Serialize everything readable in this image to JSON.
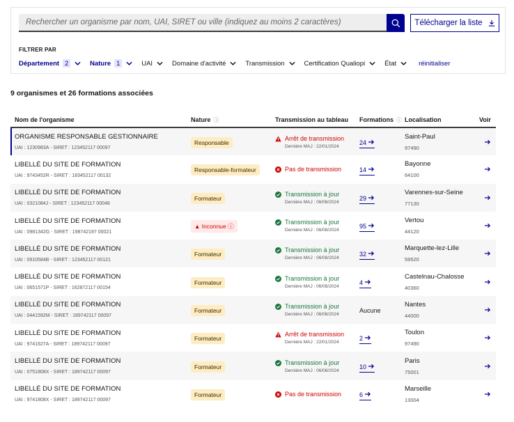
{
  "search": {
    "placeholder": "Rechercher un organisme par nom, UAI, SIRET ou ville (indiquez au moins 2 caractères)",
    "download_label": "Télécharger la liste"
  },
  "filters": {
    "title": "FILTRER PAR",
    "items": [
      {
        "label": "Département",
        "count": "2",
        "active": true
      },
      {
        "label": "Nature",
        "count": "1",
        "active": true
      },
      {
        "label": "UAI",
        "active": false
      },
      {
        "label": "Domaine d'activité",
        "active": false
      },
      {
        "label": "Transmission",
        "active": false
      },
      {
        "label": "Certification Qualiopi",
        "active": false
      },
      {
        "label": "État",
        "active": false
      }
    ],
    "reset_label": "réinitialiser"
  },
  "summary": "9 organismes et 26 formations associées",
  "table": {
    "headers": {
      "name": "Nom de l'organisme",
      "nature": "Nature",
      "transmission": "Transmission au tableau",
      "formations": "Formations",
      "location": "Localisation",
      "view": "Voir"
    },
    "rows": [
      {
        "name": "ORGANISME RESPONSABLE GESTIONNAIRE",
        "ids": "UAI : 1230983A - SIRET : 123452117 00097",
        "nature": "Responsable",
        "nature_style": "yellow",
        "tx_status": "ko-warn",
        "tx_label": "Arrêt de transmission",
        "tx_date": "Dernière MAJ : 22/01/2024",
        "formations": "24",
        "city": "Saint-Paul",
        "zip": "97490"
      },
      {
        "name": "LIBELLÉ DU SITE DE FORMATION",
        "ids": "UAI : 9743452R - SIRET : 183452117 00132",
        "nature": "Responsable-formateur",
        "nature_style": "yellow",
        "tx_status": "ko-none",
        "tx_label": "Pas de transmission",
        "tx_date": "",
        "formations": "14",
        "city": "Bayonne",
        "zip": "64100"
      },
      {
        "name": "LIBELLÉ DU SITE DE FORMATION",
        "ids": "UAI : 0321084J - SIRET : 123452117 00048",
        "nature": "Formateur",
        "nature_style": "yellow",
        "tx_status": "ok",
        "tx_label": "Transmission à jour",
        "tx_date": "Dernière MAJ : 06/08/2024",
        "formations": "29",
        "city": "Varennes-sur-Seine",
        "zip": "77130"
      },
      {
        "name": "LIBELLÉ DU SITE DE FORMATION",
        "ids": "UAI : 0981342G - SIRET : 198742197 00021",
        "nature": "Inconnue",
        "nature_style": "red",
        "tx_status": "ok",
        "tx_label": "Transmission à jour",
        "tx_date": "Dernière MAJ : 06/08/2024",
        "formations": "95",
        "city": "Vertou",
        "zip": "44120"
      },
      {
        "name": "LIBELLÉ DU SITE DE FORMATION",
        "ids": "UAI : 0910584B - SIRET : 123452117 00121",
        "nature": "Formateur",
        "nature_style": "yellow",
        "tx_status": "ok",
        "tx_label": "Transmission à jour",
        "tx_date": "Dernière MAJ : 06/08/2024",
        "formations": "32",
        "city": "Marquette-lez-Lille",
        "zip": "59520"
      },
      {
        "name": "LIBELLÉ DU SITE DE FORMATION",
        "ids": "UAI : 0651571P - SIRET : 162872117 00154",
        "nature": "Formateur",
        "nature_style": "yellow",
        "tx_status": "ok",
        "tx_label": "Transmission à jour",
        "tx_date": "Dernière MAJ : 06/08/2024",
        "formations": "4",
        "city": "Castelnau-Chalosse",
        "zip": "40360"
      },
      {
        "name": "LIBELLÉ DU SITE DE FORMATION",
        "ids": "UAI : 0441592M - SIRET : 189742117 00097",
        "nature": "Formateur",
        "nature_style": "yellow",
        "tx_status": "ok",
        "tx_label": "Transmission à jour",
        "tx_date": "Dernière MAJ : 06/08/2024",
        "formations": "",
        "formations_text": "Aucune",
        "city": "Nantes",
        "zip": "44000"
      },
      {
        "name": "LIBELLÉ DU SITE DE FORMATION",
        "ids": "UAI : 9741627A - SIRET : 189742117 00097",
        "nature": "Formateur",
        "nature_style": "yellow",
        "tx_status": "ko-warn",
        "tx_label": "Arrêt de transmission",
        "tx_date": "Dernière MAJ : 22/01/2024",
        "formations": "2",
        "city": "Toulon",
        "zip": "97490"
      },
      {
        "name": "LIBELLÉ DU SITE DE FORMATION",
        "ids": "UAI : 0751808X - SIRET : 189742117 00097",
        "nature": "Formateur",
        "nature_style": "yellow",
        "tx_status": "ok",
        "tx_label": "Transmission à jour",
        "tx_date": "Dernière MAJ : 06/08/2024",
        "formations": "10",
        "city": "Paris",
        "zip": "75001"
      },
      {
        "name": "LIBELLÉ DU SITE DE FORMATION",
        "ids": "UAI : 9741808X - SIRET : 189742117 00097",
        "nature": "Formateur",
        "nature_style": "yellow",
        "tx_status": "ko-none",
        "tx_label": "Pas de transmission",
        "tx_date": "",
        "formations": "6",
        "city": "Marseille",
        "zip": "13004"
      }
    ]
  },
  "colors": {
    "primary": "#000091",
    "success": "#18753c",
    "error": "#ce0500",
    "badge_yellow": "#feecc2",
    "badge_red": "#ffe9e9"
  }
}
